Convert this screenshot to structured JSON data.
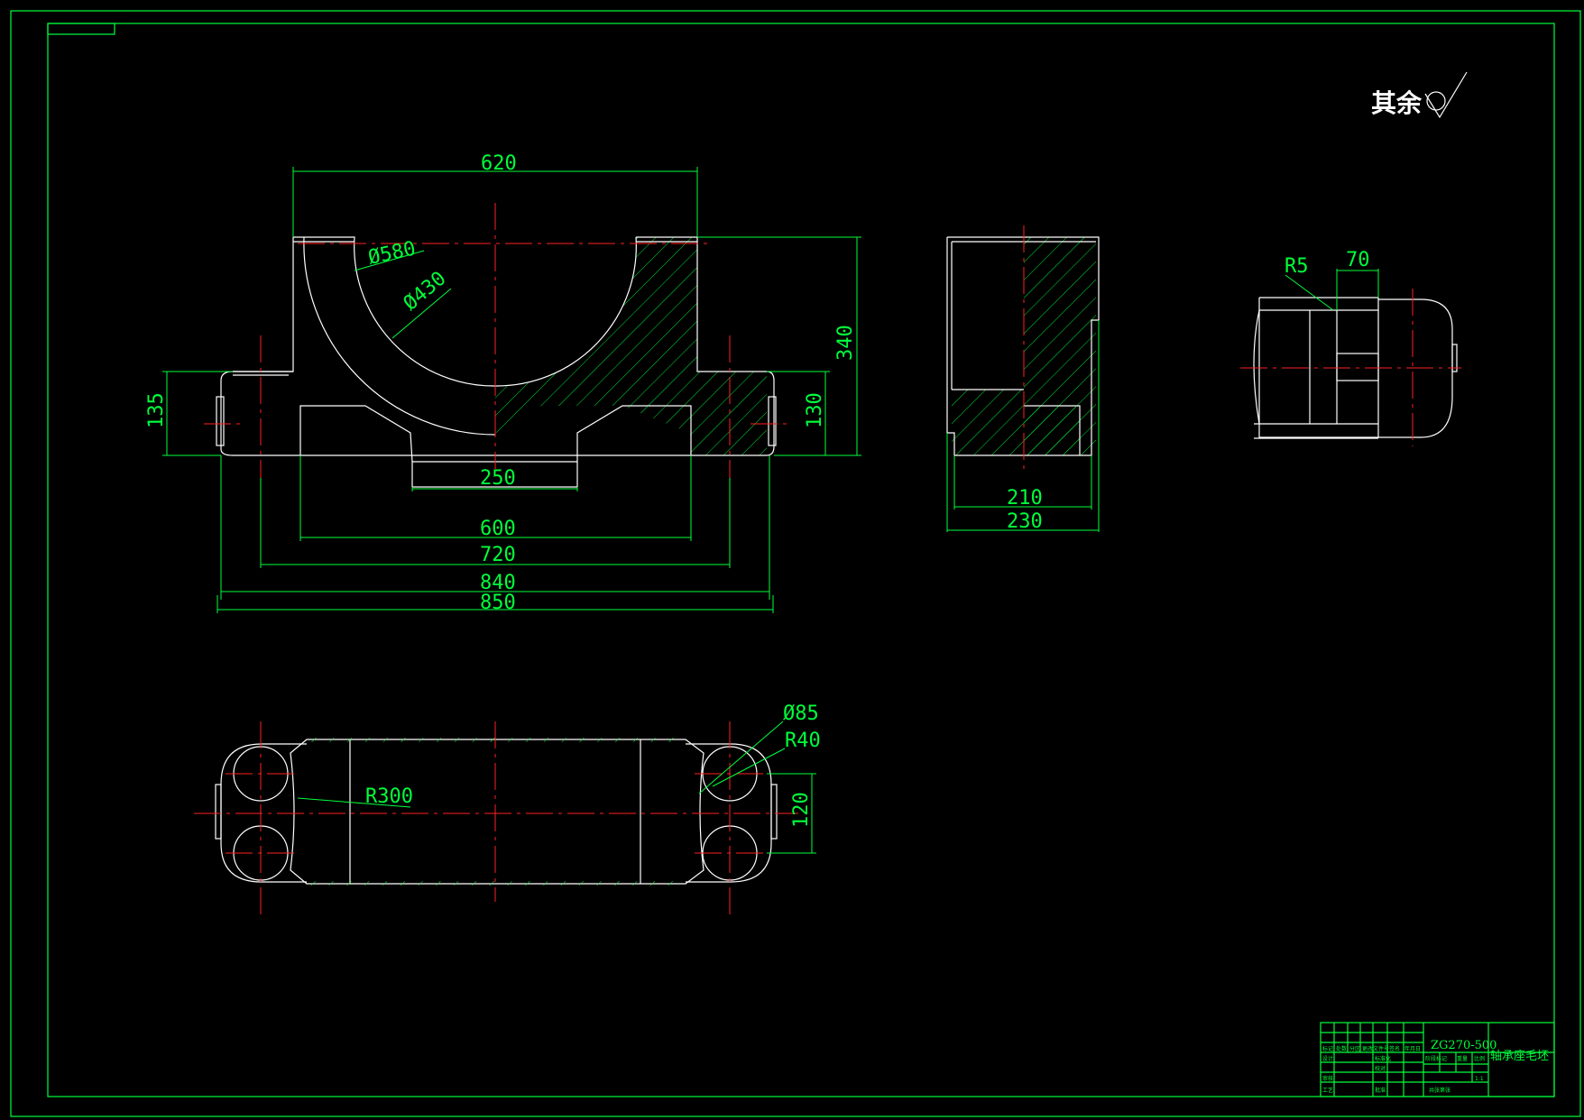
{
  "drawing": {
    "surface_note": "其余",
    "colors": {
      "background": "#000000",
      "outline": "#ffffff",
      "dimension": "#00ff3c",
      "centerline": "#ff2020"
    },
    "front_view": {
      "dims": {
        "width_top": "620",
        "dia_outer": "Ø580",
        "dia_inner": "Ø430",
        "height_total": "340",
        "flange_height_left": "135",
        "flange_height_right": "130",
        "bottom_recess": "250",
        "base_600": "600",
        "bolt_spacing": "720",
        "width_840": "840",
        "width_850": "850"
      }
    },
    "side_view": {
      "dims": {
        "width_210": "210",
        "width_230": "230"
      }
    },
    "detail_view": {
      "dims": {
        "radius": "R5",
        "width_70": "70"
      }
    },
    "top_view": {
      "dims": {
        "hole_dia": "Ø85",
        "corner_radius": "R40",
        "arc_radius": "R300",
        "hole_spacing": "120"
      }
    },
    "title_block": {
      "drawing_number": "ZG270-500",
      "part_name": "轴承座毛坯",
      "scale": "1:1",
      "labels": {
        "mark": "标记",
        "count": "处数",
        "zone": "分区",
        "change_doc": "更改文件号",
        "signature": "签名",
        "date": "年月日",
        "design": "设计",
        "standardize": "标准化",
        "review": "审核",
        "process": "工艺",
        "check": "校对",
        "approve": "批准",
        "stage_mark": "阶段标记",
        "weight": "重量",
        "ratio": "比例",
        "sheets": "共张第张"
      }
    }
  }
}
